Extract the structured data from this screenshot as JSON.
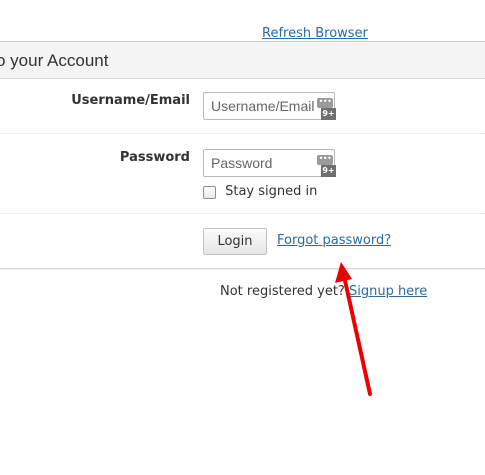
{
  "top": {
    "refresh_link": "Refresh Browser"
  },
  "panel": {
    "title": "o your Account"
  },
  "form": {
    "username_label": "Username/Email",
    "username_placeholder": "Username/Email",
    "username_value": "",
    "password_label": "Password",
    "password_placeholder": "Password",
    "password_value": "",
    "password_manager_badge": "9+",
    "password_manager_icon": "password-manager-icon",
    "stay_signed_in_label": "Stay signed in",
    "stay_signed_in_checked": false,
    "login_button": "Login",
    "forgot_password_link": "Forgot password?"
  },
  "footer": {
    "not_registered_text": "Not registered yet?",
    "signup_link": "Signup here"
  },
  "annotation": {
    "arrow_color": "#ee0000",
    "arrow_target": "forgot-password-link"
  }
}
